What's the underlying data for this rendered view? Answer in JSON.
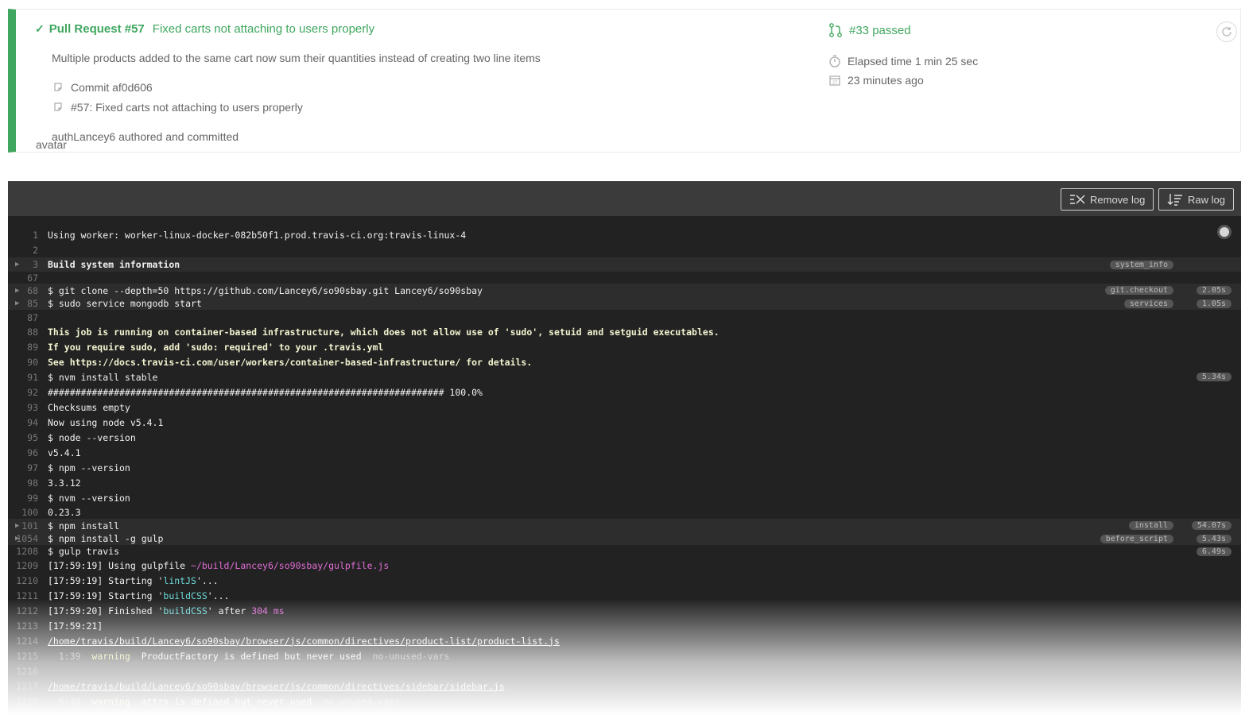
{
  "header": {
    "pr_label": "Pull Request #57",
    "pr_message": "Fixed carts not attaching to users properly",
    "description": "Multiple products added to the same cart now sum their quantities instead of creating two line items",
    "commit": "Commit af0d606",
    "pr_ref": "#57: Fixed carts not attaching to users properly",
    "author_line": "authLancey6 authored and committed",
    "avatar_alt": "avatar",
    "build_status": "#33 passed",
    "elapsed": "Elapsed time 1 min 25 sec",
    "ago": "23 minutes ago",
    "accent_color": "#3fa75f"
  },
  "toolbar": {
    "remove_log": "Remove log",
    "raw_log": "Raw log"
  },
  "log": [
    {
      "n": "1",
      "t": "Using worker: worker-linux-docker-082b50f1.prod.travis-ci.org:travis-linux-4"
    },
    {
      "n": "2",
      "t": ""
    },
    {
      "n": "3",
      "t": "Build system information",
      "fold": true,
      "style": "bold2",
      "tag": "system_info"
    },
    {
      "n": "67",
      "t": ""
    },
    {
      "n": "68",
      "t": "$ git clone --depth=50 https://github.com/Lancey6/so90sbay.git Lancey6/so90sbay",
      "fold": true,
      "tag": "git.checkout",
      "dur": "2.05s"
    },
    {
      "n": "85",
      "t": "$ sudo service mongodb start",
      "fold": true,
      "tag": "services",
      "dur": "1.05s"
    },
    {
      "n": "87",
      "t": ""
    },
    {
      "n": "88",
      "t": "This job is running on container-based infrastructure, which does not allow use of 'sudo', setuid and setguid executables.",
      "style": "bold"
    },
    {
      "n": "89",
      "t": "If you require sudo, add 'sudo: required' to your .travis.yml",
      "style": "bold"
    },
    {
      "n": "90",
      "t": "See https://docs.travis-ci.com/user/workers/container-based-infrastructure/ for details.",
      "style": "bold"
    },
    {
      "n": "91",
      "t": "$ nvm install stable",
      "dur": "5.34s"
    },
    {
      "n": "92",
      "t": "######################################################################## 100.0%"
    },
    {
      "n": "93",
      "t": "Checksums empty"
    },
    {
      "n": "94",
      "t": "Now using node v5.4.1"
    },
    {
      "n": "95",
      "t": "$ node --version"
    },
    {
      "n": "96",
      "t": "v5.4.1"
    },
    {
      "n": "97",
      "t": "$ npm --version"
    },
    {
      "n": "98",
      "t": "3.3.12"
    },
    {
      "n": "99",
      "t": "$ nvm --version"
    },
    {
      "n": "100",
      "t": "0.23.3"
    },
    {
      "n": "101",
      "t": "$ npm install",
      "fold": true,
      "tag": "install",
      "dur": "54.07s"
    },
    {
      "n": "1054",
      "t": "$ npm install -g gulp",
      "fold": true,
      "tag": "before_script",
      "dur": "5.43s"
    },
    {
      "n": "1208",
      "t": "$ gulp travis",
      "dur": "6.49s"
    },
    {
      "n": "1209",
      "parts": [
        [
          "[17:59:19] Using gulpfile ",
          ""
        ],
        [
          "~/build/Lancey6/so90sbay/gulpfile.js",
          "c-magenta"
        ]
      ]
    },
    {
      "n": "1210",
      "parts": [
        [
          "[17:59:19] Starting '",
          ""
        ],
        [
          "lintJS",
          "c-cyan"
        ],
        [
          "'...",
          ""
        ]
      ]
    },
    {
      "n": "1211",
      "parts": [
        [
          "[17:59:19] Starting '",
          ""
        ],
        [
          "buildCSS",
          "c-cyan"
        ],
        [
          "'...",
          ""
        ]
      ]
    },
    {
      "n": "1212",
      "parts": [
        [
          "[17:59:20] Finished '",
          ""
        ],
        [
          "buildCSS",
          "c-cyan"
        ],
        [
          "' after ",
          ""
        ],
        [
          "304 ms",
          "c-magenta"
        ]
      ]
    },
    {
      "n": "1213",
      "t": "[17:59:21]"
    },
    {
      "n": "1214",
      "parts": [
        [
          "/home/travis/build/Lancey6/so90sbay/browser/js/common/directives/product-list/product-list.js",
          "u"
        ]
      ]
    },
    {
      "n": "1215",
      "parts": [
        [
          "  1:39  ",
          "c-grey"
        ],
        [
          "warning",
          "c-yellow"
        ],
        [
          "  ProductFactory is defined but never used  ",
          ""
        ],
        [
          "no-unused-vars",
          "c-grey"
        ]
      ]
    },
    {
      "n": "1216",
      "t": ""
    },
    {
      "n": "1217",
      "parts": [
        [
          "/home/travis/build/Lancey6/so90sbay/browser/js/common/directives/sidebar/sidebar.js",
          "u"
        ]
      ]
    },
    {
      "n": "1218",
      "parts": [
        [
          "  6:38  ",
          "c-grey"
        ],
        [
          "warning",
          "c-yellow"
        ],
        [
          "  attrs is defined but never used  ",
          ""
        ],
        [
          "no-unused-vars",
          "c-grey"
        ]
      ]
    }
  ]
}
